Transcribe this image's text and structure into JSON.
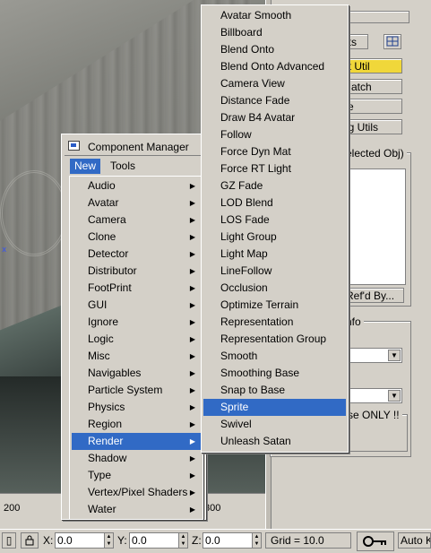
{
  "window": {
    "title": "Component Manager"
  },
  "menubar": [
    {
      "label": "New",
      "active": true
    },
    {
      "label": "Tools",
      "active": false
    }
  ],
  "new_menu": {
    "items": [
      "Audio",
      "Avatar",
      "Camera",
      "Clone",
      "Detector",
      "Distributor",
      "FootPrint",
      "GUI",
      "Ignore",
      "Logic",
      "Misc",
      "Navigables",
      "Particle System",
      "Physics",
      "Region",
      "Render",
      "Shadow",
      "Type",
      "Vertex/Pixel Shaders",
      "Water"
    ],
    "selected": "Render"
  },
  "render_submenu": {
    "items": [
      "Avatar Smooth",
      "Billboard",
      "Blend Onto",
      "Blend Onto Advanced",
      "Camera View",
      "Distance Fade",
      "Draw B4 Avatar",
      "Follow",
      "Force Dyn Mat",
      "Force RT Light",
      "GZ Fade",
      "LOD Blend",
      "LOS Fade",
      "Light Group",
      "Light Map",
      "LineFollow",
      "Occlusion",
      "Optimize Terrain",
      "Representation",
      "Representation Group",
      "Smooth",
      "Smoothing Base",
      "Snap to Base",
      "Sprite",
      "Swivel",
      "Unleash Satan"
    ],
    "selected": "Sprite"
  },
  "ruler": {
    "ticks": [
      "200",
      "300"
    ]
  },
  "right_panel": {
    "buttons": [
      "ets",
      "nt Util",
      "Match",
      "se",
      "ug Utils"
    ],
    "group_title": "elected Obj)",
    "refd_button": "Ref'd By...",
    "info_title": "nfo",
    "note": "se ONLY !!"
  },
  "statusbar": {
    "x_label": "X:",
    "x_value": "0.0",
    "y_label": "Y:",
    "y_value": "0.0",
    "z_label": "Z:",
    "z_value": "0.0",
    "grid": "Grid = 10.0",
    "autokey": "Auto Ke"
  },
  "colors": {
    "selection": "#316ac5",
    "panel": "#d4d0c8",
    "highlight_button": "#f0d73a"
  },
  "icons": [
    "lock-icon",
    "key-icon",
    "submenu-arrow-icon",
    "dropdown-arrow-icon"
  ]
}
